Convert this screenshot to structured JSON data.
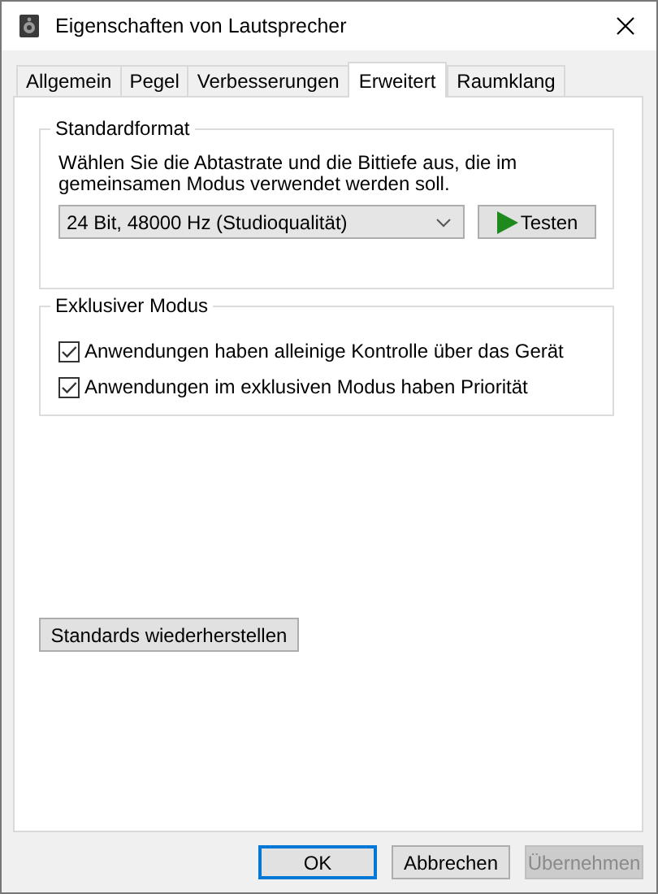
{
  "window": {
    "title": "Eigenschaften von Lautsprecher"
  },
  "tabs": [
    {
      "label": "Allgemein",
      "selected": false
    },
    {
      "label": "Pegel",
      "selected": false
    },
    {
      "label": "Verbesserungen",
      "selected": false
    },
    {
      "label": "Erweitert",
      "selected": true
    },
    {
      "label": "Raumklang",
      "selected": false
    }
  ],
  "standard_format": {
    "title": "Standardformat",
    "description": "Wählen Sie die Abtastrate und die Bittiefe aus, die im gemeinsamen Modus verwendet werden soll.",
    "dropdown": {
      "value": "24 Bit, 48000 Hz (Studioqualität)"
    },
    "test_button": {
      "label": "Testen"
    }
  },
  "exclusive_mode": {
    "title": "Exklusiver Modus",
    "options": [
      {
        "label": "Anwendungen haben alleinige Kontrolle über das Gerät",
        "checked": true
      },
      {
        "label": "Anwendungen im exklusiven Modus haben Priorität",
        "checked": true
      }
    ]
  },
  "reset_button": {
    "label": "Standards wiederherstellen"
  },
  "buttons": [
    {
      "label": "OK",
      "default": true,
      "disabled": false
    },
    {
      "label": "Abbrechen",
      "default": false,
      "disabled": false
    },
    {
      "label": "Übernehmen",
      "default": false,
      "disabled": true
    }
  ]
}
